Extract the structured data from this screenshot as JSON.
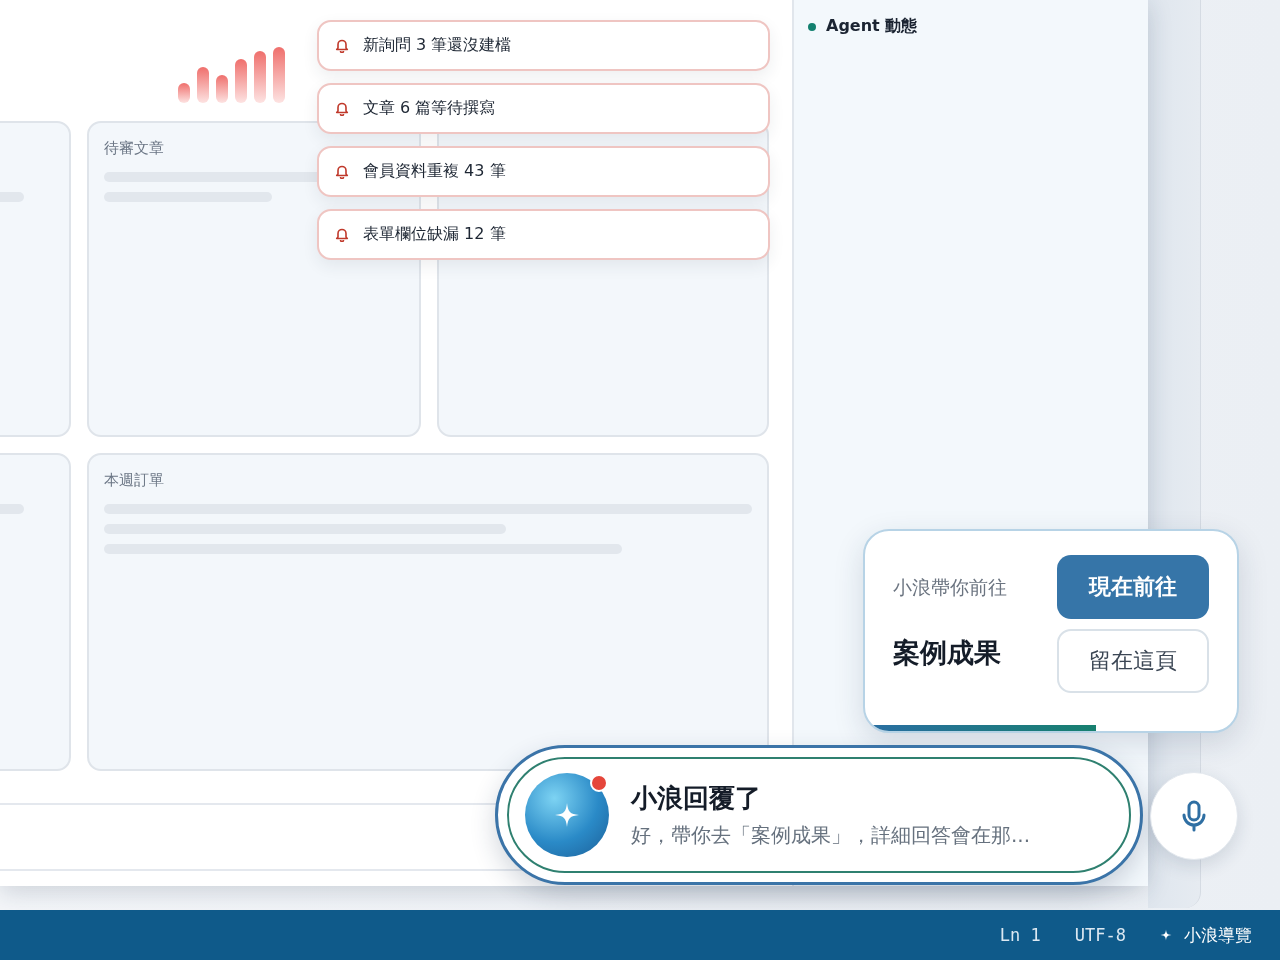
{
  "notifications": [
    {
      "text": "新詢問 3 筆還沒建檔"
    },
    {
      "text": "文章 6 篇等待撰寫"
    },
    {
      "text": "會員資料重複 43 筆"
    },
    {
      "text": "表單欄位缺漏 12 筆"
    }
  ],
  "cards": [
    {
      "title": "待審文章"
    },
    {
      "title": "本週訂單"
    }
  ],
  "side_panel": {
    "title": "Agent 動態",
    "color": "#13806f"
  },
  "nav_prompt": {
    "label": "小浪帶你前往",
    "destination": "案例成果",
    "buttons": [
      {
        "label": "現在前往",
        "kind": "primary"
      },
      {
        "label": "留在這頁",
        "kind": "secondary"
      }
    ],
    "level": 0.62
  },
  "reply_toast": {
    "title": "小浪回覆了",
    "message": "好，帶你去「案例成果」，詳細回答會在那...",
    "unread": true
  },
  "status_bar": {
    "items": [
      {
        "text": "Ln 1",
        "kind": "plain"
      },
      {
        "text": "UTF-8",
        "kind": "plain"
      },
      {
        "text": "小浪導覽",
        "kind": "assistant"
      }
    ]
  }
}
